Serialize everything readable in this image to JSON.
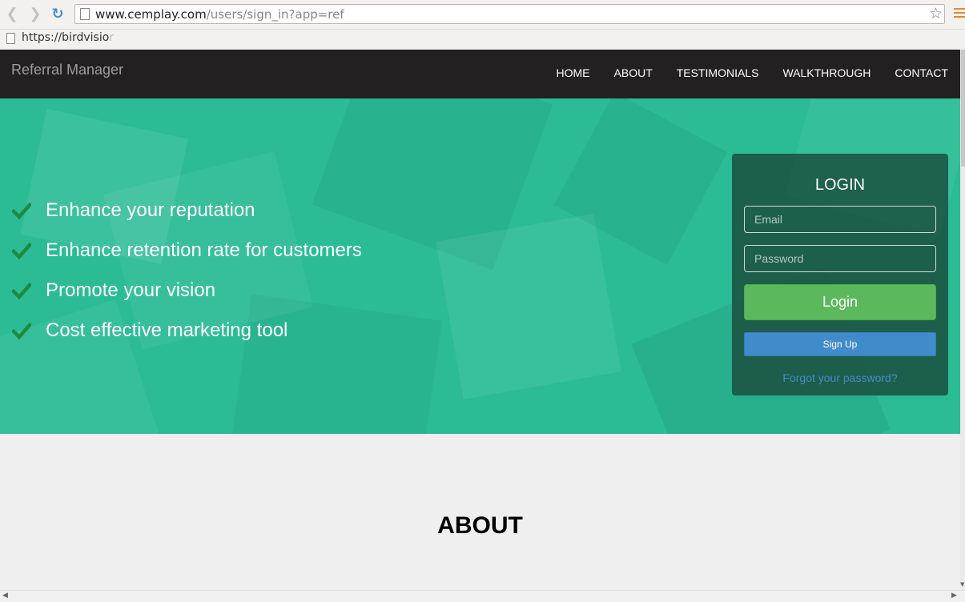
{
  "browser": {
    "url_host": "www.cemplay.com",
    "url_path": "/users/sign_in?app=ref",
    "status_text": "https://birdvisio",
    "status_text_faded": "r",
    "back_icon": "chevron-left-icon",
    "forward_icon": "chevron-right-icon",
    "reload_icon": "reload-icon",
    "star_icon": "star-icon",
    "menu_icon": "hamburger-menu-icon"
  },
  "navbar": {
    "brand": "Referral Manager",
    "links": [
      "HOME",
      "ABOUT",
      "TESTIMONIALS",
      "WALKTHROUGH",
      "CONTACT"
    ]
  },
  "hero": {
    "features": [
      "Enhance your reputation",
      "Enhance retention rate for customers",
      "Promote your vision",
      "Cost effective marketing tool"
    ],
    "check_color": "#1f8a3c",
    "background_color": "#2bbc96"
  },
  "login": {
    "title": "LOGIN",
    "email_placeholder": "Email",
    "password_placeholder": "Password",
    "login_button": "Login",
    "signup_button": "Sign Up",
    "forgot_link": "Forgot your password?"
  },
  "about": {
    "heading": "ABOUT"
  }
}
